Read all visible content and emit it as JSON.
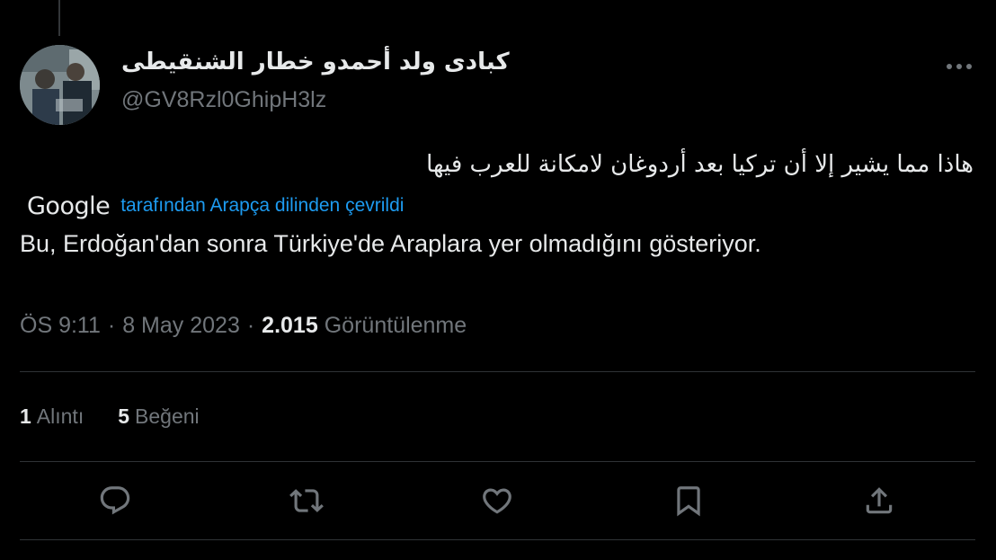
{
  "author": {
    "display_name": "كبادى ولد أحمدو خطار الشنقيطى",
    "handle": "@GV8Rzl0GhipH3lz"
  },
  "tweet": {
    "original_text": "هاذا مما يشير إلا أن تركيا بعد أردوغان لامكانة للعرب فيها",
    "translation_provider": "Google",
    "translation_note": "tarafından Arapça dilinden çevrildi",
    "translated_text": "Bu, Erdoğan'dan sonra Türkiye'de Araplara yer olmadığını gösteriyor."
  },
  "meta": {
    "time": "ÖS 9:11",
    "separator": "·",
    "date": "8 May 2023",
    "views_count": "2.015",
    "views_label": "Görüntülenme"
  },
  "stats": {
    "quotes_count": "1",
    "quotes_label": "Alıntı",
    "likes_count": "5",
    "likes_label": "Beğeni"
  },
  "actions": {
    "icons": [
      "reply-icon",
      "retweet-icon",
      "like-icon",
      "bookmark-icon",
      "share-icon"
    ]
  },
  "colors": {
    "background": "#000000",
    "text_primary": "#e7e9ea",
    "text_secondary": "#71767b",
    "link": "#1d9bf0",
    "divider": "#2f3336"
  }
}
